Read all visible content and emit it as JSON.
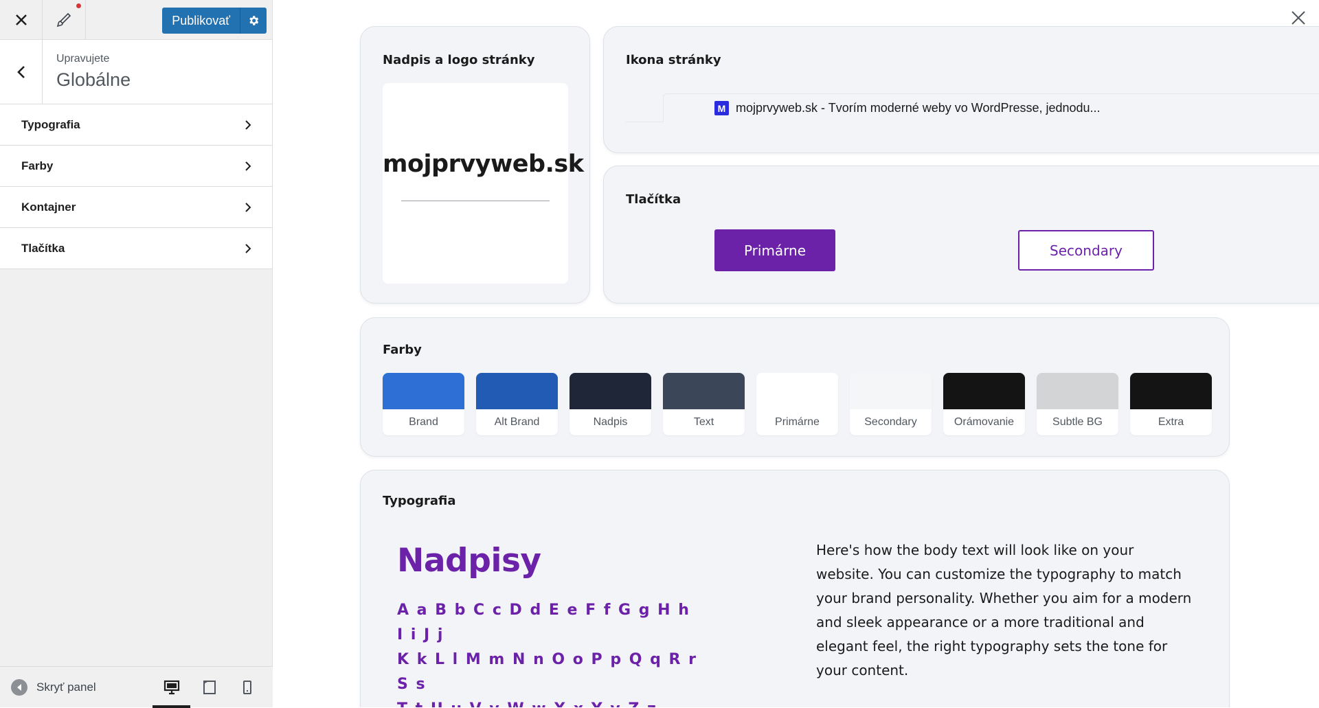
{
  "topbar": {
    "publish_label": "Publikovať"
  },
  "section": {
    "editing_label": "Upravujete",
    "title": "Globálne"
  },
  "menu": {
    "items": [
      {
        "label": "Typografia"
      },
      {
        "label": "Farby"
      },
      {
        "label": "Kontajner"
      },
      {
        "label": "Tlačítka"
      }
    ]
  },
  "footer": {
    "collapse_label": "Skryť panel"
  },
  "preview": {
    "logo_card": {
      "title": "Nadpis a logo stránky",
      "site_name": "mojprvyweb.sk"
    },
    "icon_card": {
      "title": "Ikona stránky",
      "favicon_letter": "M",
      "tab_title": "mojprvyweb.sk - Tvorím moderné weby vo WordPresse, jednodu..."
    },
    "buttons_card": {
      "title": "Tlačítka",
      "primary_label": "Primárne",
      "secondary_label": "Secondary"
    },
    "colors_card": {
      "title": "Farby",
      "swatches": [
        {
          "label": "Brand",
          "color": "#2e6fd6"
        },
        {
          "label": "Alt Brand",
          "color": "#215bb4"
        },
        {
          "label": "Nadpis",
          "color": "#1e2638"
        },
        {
          "label": "Text",
          "color": "#3b4658"
        },
        {
          "label": "Primárne",
          "color": "#ffffff"
        },
        {
          "label": "Secondary",
          "color": "#f5f6f8"
        },
        {
          "label": "Orámovanie",
          "color": "#141414"
        },
        {
          "label": "Subtle BG",
          "color": "#d3d4d6"
        },
        {
          "label": "Extra",
          "color": "#141414"
        }
      ]
    },
    "typography_card": {
      "title": "Typografia",
      "heading_sample": "Nadpisy",
      "alphabet_lines": [
        "A a B b C c D d E e F f G g H h I i J j",
        "K k L l M m N n O o P p Q q R r S s",
        "T t U u V v W w X x Y y Z z"
      ],
      "body_sample": "Here's how the body text will look like on your website. You can customize the typography to match your brand personality. Whether you aim for a modern and sleek appearance or a more traditional and elegant feel, the right typography sets the tone for your content."
    }
  },
  "colors": {
    "accent": "#2271b1",
    "brand_purple": "#6b21a8",
    "notification": "#d63638"
  },
  "icons": [
    "close-icon",
    "brush-icon",
    "gear-icon",
    "back-arrow-icon",
    "chevron-right-icon",
    "collapse-arrow-icon",
    "desktop-icon",
    "tablet-icon",
    "mobile-icon"
  ]
}
